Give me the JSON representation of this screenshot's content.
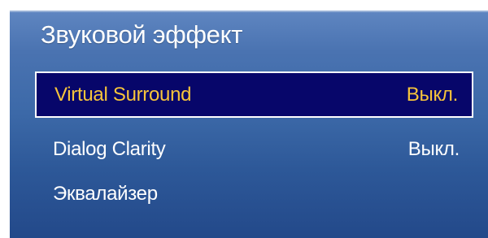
{
  "window": {
    "title": "Звуковой эффект"
  },
  "menu": {
    "items": [
      {
        "label": "Virtual Surround",
        "value": "Выкл.",
        "selected": true
      },
      {
        "label": "Dialog Clarity",
        "value": "Выкл.",
        "selected": false
      },
      {
        "label": "Эквалайзер",
        "value": "",
        "selected": false
      }
    ]
  },
  "colors": {
    "panel_top": "#5f86c1",
    "panel_bottom": "#23498a",
    "selected_bg": "#07066a",
    "selected_text": "#f6c43b",
    "text": "#ffffff"
  }
}
